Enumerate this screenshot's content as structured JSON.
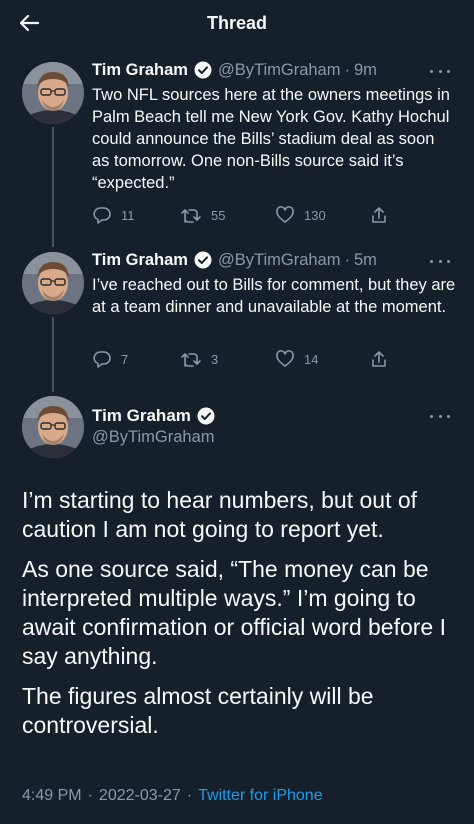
{
  "header": {
    "title": "Thread",
    "back_icon": "arrow-left-icon"
  },
  "colors": {
    "background": "#15202b",
    "accent": "#1d9bf0",
    "muted": "#8b98a5",
    "text": "#f7f9f9"
  },
  "tweets": [
    {
      "name": "Tim Graham",
      "handle": "@ByTimGraham",
      "separator": "·",
      "time": "9m",
      "text": "Two NFL sources here at the owners meetings in Palm Beach tell me New York Gov. Kathy Hochul could announce the Bills’ stadium deal as soon as tomorrow. One non-Bills source said it’s “expected.”",
      "replies": "11",
      "retweets": "55",
      "likes": "130"
    },
    {
      "name": "Tim Graham",
      "handle": "@ByTimGraham",
      "separator": "·",
      "time": "5m",
      "text": "I’ve reached out to Bills for comment, but they are at a team dinner and unavailable at the moment.",
      "replies": "7",
      "retweets": "3",
      "likes": "14"
    }
  ],
  "main": {
    "name": "Tim Graham",
    "handle": "@ByTimGraham",
    "paragraphs": [
      "I’m starting to hear numbers, but out of caution I am not going to report yet.",
      "As one source said, “The money can be interpreted multiple ways.” I’m going to await confirmation or official word before I say anything.",
      "The figures almost certainly will be controversial."
    ],
    "time": "4:49 PM",
    "separator": "·",
    "date": "2022-03-27",
    "source": "Twitter for iPhone"
  }
}
